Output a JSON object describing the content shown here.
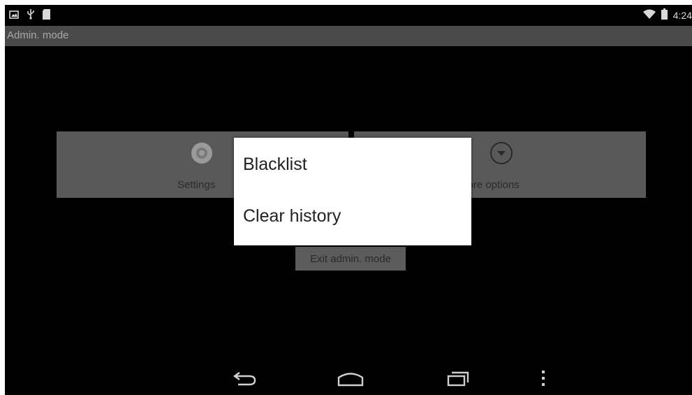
{
  "status_bar": {
    "icons_left": [
      "screenshot-icon",
      "usb-icon",
      "sd-card-icon"
    ],
    "icons_right": [
      "wifi-icon",
      "battery-icon"
    ],
    "time": "4:24"
  },
  "title_bar": {
    "title": "Admin. mode"
  },
  "tiles": {
    "settings": {
      "label": "Settings",
      "icon": "gear-icon"
    },
    "more_options": {
      "label": "More options",
      "icon": "chevron-down-circle-icon"
    }
  },
  "exit_button": {
    "label": "Exit admin. mode"
  },
  "popup_menu": {
    "items": [
      {
        "label": "Blacklist"
      },
      {
        "label": "Clear history"
      }
    ]
  },
  "nav_bar": {
    "buttons": [
      "back-icon",
      "home-icon",
      "recents-icon",
      "overflow-menu-icon"
    ]
  },
  "colors": {
    "screen_bg": "#000000",
    "title_bar": "#4a4a4a",
    "tile": "#595959",
    "menu_bg": "#ffffff"
  }
}
